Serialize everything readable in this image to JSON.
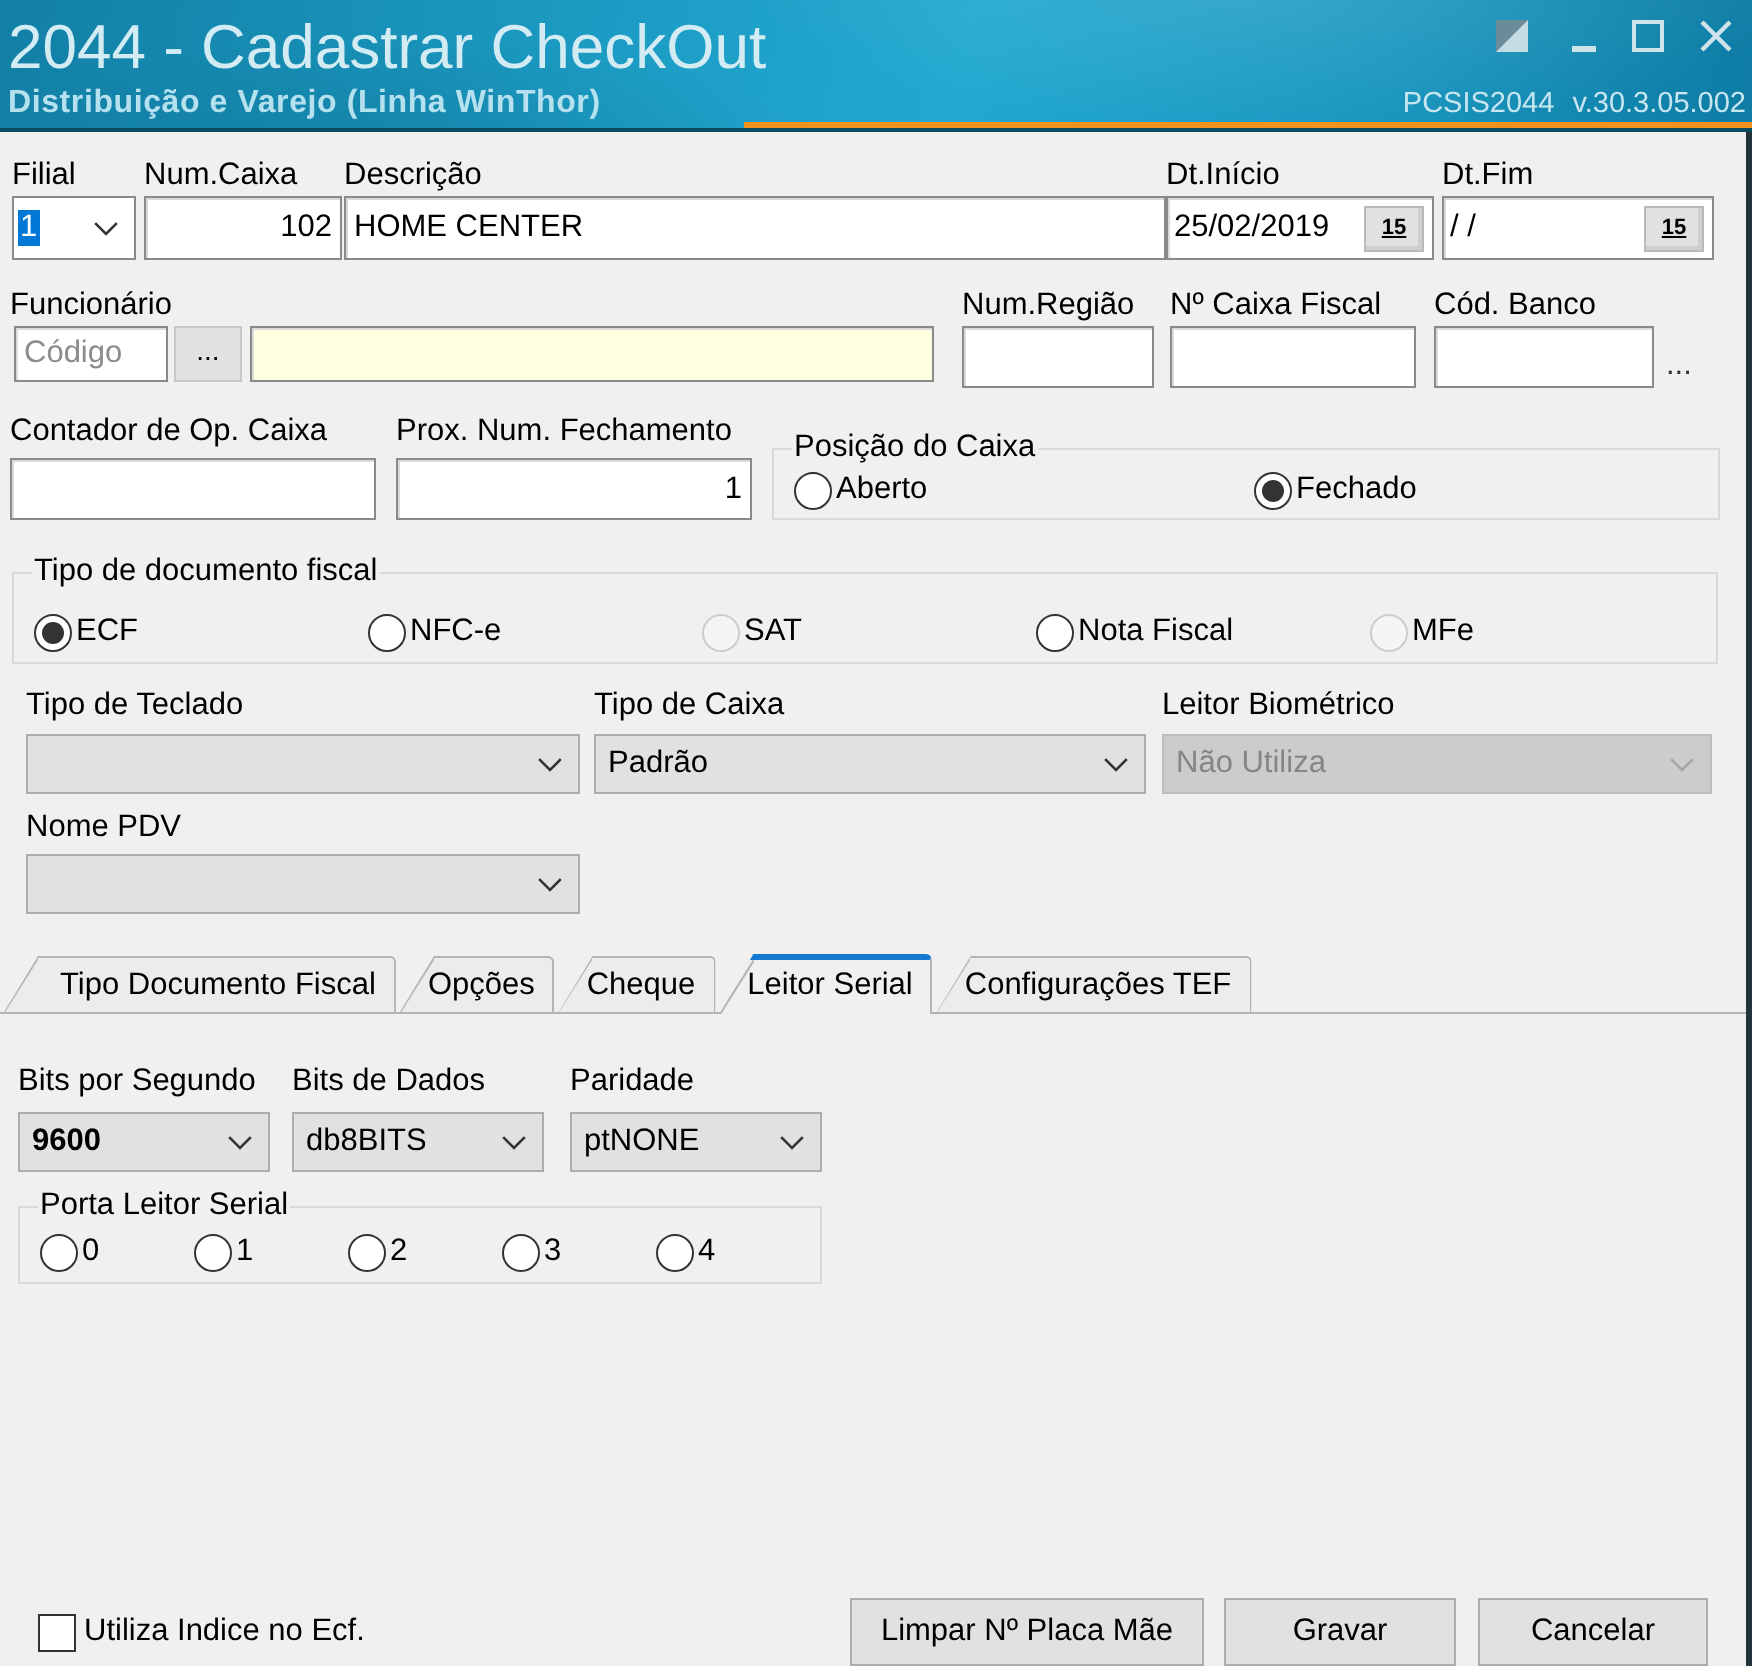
{
  "window": {
    "title": "2044 - Cadastrar CheckOut",
    "subtitle": "Distribuição e Varejo (Linha WinThor)",
    "program": "PCSIS2044",
    "version": "v.30.3.05.002"
  },
  "filial": {
    "label": "Filial",
    "value": "1",
    "value_selected": true
  },
  "top_fields": [
    {
      "kind": "number",
      "label": "Num.Caixa",
      "value": "102"
    },
    {
      "kind": "text",
      "label": "Descrição",
      "value": "HOME CENTER"
    },
    {
      "kind": "date",
      "label": "Dt.Início",
      "value": "25/02/2019",
      "calendar": "15"
    },
    {
      "kind": "date",
      "label": "Dt.Fim",
      "value": "/ /",
      "calendar": "15"
    }
  ],
  "funcionario": {
    "label": "Funcionário",
    "code_field": {
      "placeholder": "Código"
    },
    "lookup_button": "..."
  },
  "fiscal_fields": [
    {
      "label": "Num.Região"
    },
    {
      "label": "Nº Caixa Fiscal"
    },
    {
      "label": "Cód. Banco"
    }
  ],
  "bank_lookup": "...",
  "counters": [
    {
      "kind": "text",
      "label": "Contador de Op. Caixa"
    },
    {
      "kind": "number",
      "label": "Prox. Num. Fechamento",
      "value": "1"
    }
  ],
  "posicao_do_caixa": {
    "title": "Posição do Caixa",
    "options": [
      {
        "label": "Aberto",
        "selected": false
      },
      {
        "label": "Fechado",
        "selected": true
      }
    ]
  },
  "tipo_documento_fiscal": {
    "title": "Tipo de documento fiscal",
    "options": [
      {
        "label": "ECF",
        "selected": true,
        "disabled": false
      },
      {
        "label": "NFC-e",
        "selected": false,
        "disabled": false
      },
      {
        "label": "SAT",
        "selected": false,
        "disabled": true
      },
      {
        "label": "Nota Fiscal",
        "selected": false,
        "disabled": false
      },
      {
        "label": "MFe",
        "selected": false,
        "disabled": true
      }
    ]
  },
  "selects": [
    {
      "label": "Tipo de Teclado",
      "disabled": false
    },
    {
      "label": "Tipo de Caixa",
      "value": "Padrão",
      "disabled": false
    },
    {
      "label": "Leitor Biométrico",
      "value": "Não Utiliza",
      "disabled": true
    },
    {
      "label": "Nome PDV",
      "disabled": false
    }
  ],
  "tabs": [
    {
      "label": "Tipo Documento Fiscal",
      "selected": false
    },
    {
      "label": "Opções",
      "selected": false
    },
    {
      "label": "Cheque",
      "selected": false
    },
    {
      "label": "Leitor Serial",
      "selected": true
    },
    {
      "label": "Configurações TEF",
      "selected": false
    }
  ],
  "leitor_serial": {
    "fields": [
      {
        "label": "Bits por Segundo",
        "value": "9600",
        "emphasized": true
      },
      {
        "label": "Bits de Dados",
        "value": "db8BITS",
        "emphasized": false
      },
      {
        "label": "Paridade",
        "value": "ptNONE",
        "emphasized": false
      }
    ],
    "porta": {
      "title": "Porta Leitor Serial",
      "options": [
        {
          "label": "0",
          "selected": false
        },
        {
          "label": "1",
          "selected": false
        },
        {
          "label": "2",
          "selected": false
        },
        {
          "label": "3",
          "selected": false
        },
        {
          "label": "4",
          "selected": false
        }
      ]
    }
  },
  "footer": {
    "checkbox": {
      "label": "Utiliza Indice no Ecf.",
      "checked": false
    },
    "buttons": [
      "Limpar Nº Placa Mãe",
      "Gravar",
      "Cancelar"
    ]
  }
}
